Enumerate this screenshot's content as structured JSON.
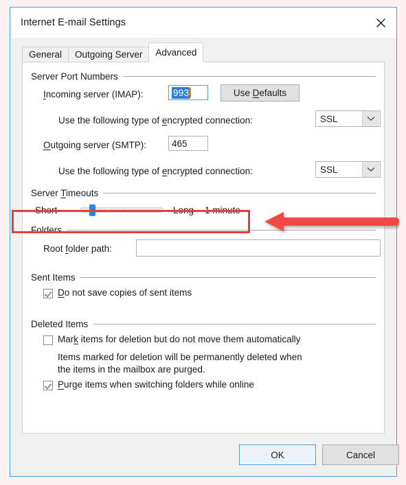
{
  "window": {
    "title": "Internet E-mail Settings",
    "close_icon": "close-icon"
  },
  "tabs": [
    {
      "label": "General",
      "active": false
    },
    {
      "label": "Outgoing Server",
      "active": false
    },
    {
      "label": "Advanced",
      "active": true
    }
  ],
  "groups": {
    "server_port_numbers": {
      "title": "Server Port Numbers",
      "incoming_label_pre": "I",
      "incoming_label_rest": "ncoming server (IMAP):",
      "incoming_value": "993",
      "use_defaults_pre": "Use ",
      "use_defaults_mid": "D",
      "use_defaults_rest": "efaults",
      "incoming_encryption_label_pre": "Use the following type of ",
      "incoming_encryption_label_mid": "e",
      "incoming_encryption_label_rest": "ncrypted connection:",
      "incoming_encryption_value": "SSL",
      "outgoing_label_pre": "O",
      "outgoing_label_rest": "utgoing server (SMTP):",
      "outgoing_value": "465",
      "outgoing_encryption_label_pre": "Use the following type of ",
      "outgoing_encryption_label_mid": "e",
      "outgoing_encryption_label_rest": "ncrypted connection:",
      "outgoing_encryption_value": "SSL"
    },
    "server_timeouts": {
      "title_pre": "Server ",
      "title_mid": "T",
      "title_rest": "imeouts",
      "short_label": "Short",
      "long_label": "Long",
      "value_label": "1 minute",
      "slider_position_percent": 12
    },
    "folders": {
      "title": "Folders",
      "root_label_pre": "Root ",
      "root_label_mid": "f",
      "root_label_rest": "older path:",
      "root_value": "",
      "root_placeholder": ""
    },
    "sent_items": {
      "title": "Sent Items",
      "checkbox_pre": "D",
      "checkbox_rest": "o not save copies of sent items",
      "checked": true
    },
    "deleted_items": {
      "title": "Deleted Items",
      "mark_pre": "Mar",
      "mark_mid": "k",
      "mark_rest": " items for deletion but do not move them automatically",
      "mark_checked": false,
      "note_line1": "Items marked for deletion will be permanently deleted when",
      "note_line2": "the items in the mailbox are purged.",
      "purge_pre": "P",
      "purge_rest": "urge items when switching folders while online",
      "purge_checked": true
    }
  },
  "footer": {
    "ok_label": "OK",
    "cancel_label": "Cancel"
  },
  "annotations": {
    "highlight_color": "#ef3b36",
    "arrow_color": "#f04a45",
    "arrow_direction": "left",
    "highlight_target": "server-timeouts-row"
  },
  "colors": {
    "accent": "#2f7fd4",
    "window_border": "#4a9fe0",
    "page_background": "#fdf0f0",
    "dialog_chrome": "#f0f0f0",
    "slider_thumb": "#2f87d8",
    "selection": "#2f7fd4",
    "caret": "#e8871e"
  }
}
